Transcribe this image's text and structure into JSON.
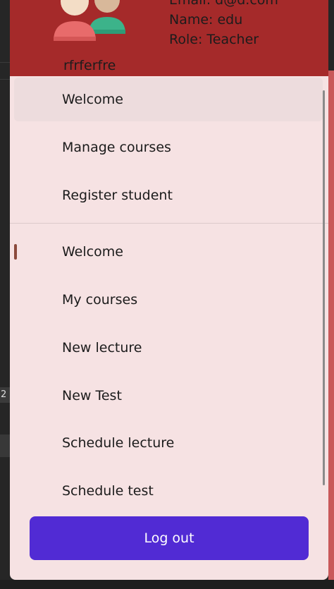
{
  "header": {
    "user_name": "rfrferfre",
    "email_line": "Email: d@d.com",
    "name_line": "Name: edu",
    "role_line": "Role: Teacher",
    "background_color": "#a52a2a",
    "avatar_icon": "users-avatar-icon"
  },
  "menu": {
    "section_one": [
      {
        "label": "Welcome",
        "selected": true
      },
      {
        "label": "Manage courses"
      },
      {
        "label": "Register student"
      }
    ],
    "section_two": [
      {
        "label": "Welcome",
        "active": true
      },
      {
        "label": "My courses"
      },
      {
        "label": "New lecture"
      },
      {
        "label": "New Test"
      },
      {
        "label": "Schedule lecture"
      },
      {
        "label": "Schedule test"
      }
    ]
  },
  "logout": {
    "label": "Log out",
    "color": "#512bd4"
  },
  "background_app": {
    "visible_number": "2"
  },
  "colors": {
    "drawer_bg": "#f6e2e3",
    "accent": "#512bd4"
  }
}
